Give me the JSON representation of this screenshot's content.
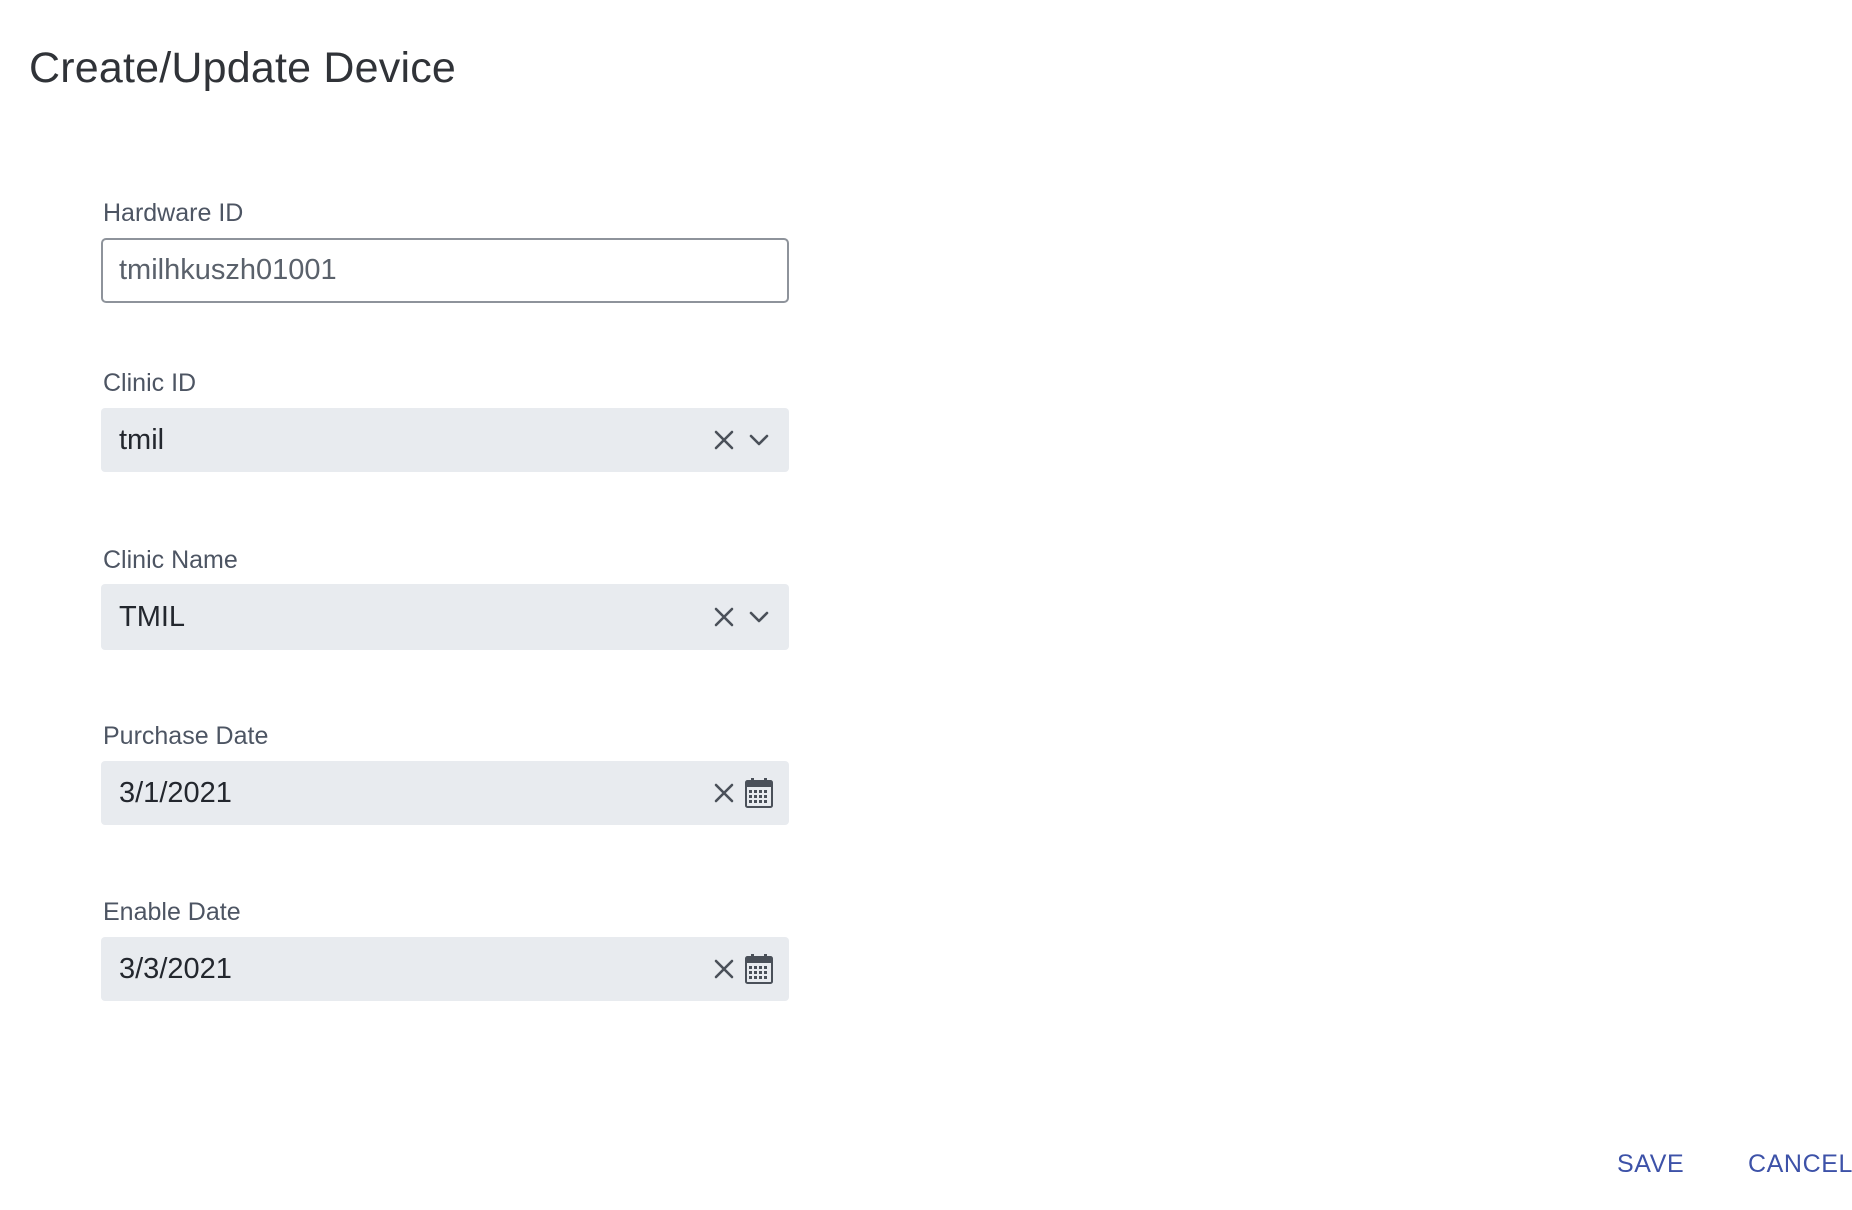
{
  "dialog": {
    "title": "Create/Update Device"
  },
  "form": {
    "hardware_id": {
      "label": "Hardware ID",
      "value": "tmilhkuszh01001"
    },
    "clinic_id": {
      "label": "Clinic ID",
      "value": "tmil",
      "clear_icon": "close-icon",
      "dropdown_icon": "chevron-down-icon"
    },
    "clinic_name": {
      "label": "Clinic Name",
      "value": "TMIL",
      "clear_icon": "close-icon",
      "dropdown_icon": "chevron-down-icon"
    },
    "purchase_date": {
      "label": "Purchase Date",
      "value": "3/1/2021",
      "clear_icon": "close-icon",
      "calendar_icon": "calendar-icon"
    },
    "enable_date": {
      "label": "Enable Date",
      "value": "3/3/2021",
      "clear_icon": "close-icon",
      "calendar_icon": "calendar-icon"
    }
  },
  "actions": {
    "save_label": "SAVE",
    "cancel_label": "CANCEL"
  },
  "colors": {
    "accent": "#3d52a8",
    "field_fill": "#e8ebef",
    "label_text": "#4d5563",
    "input_border": "#8e939b"
  }
}
